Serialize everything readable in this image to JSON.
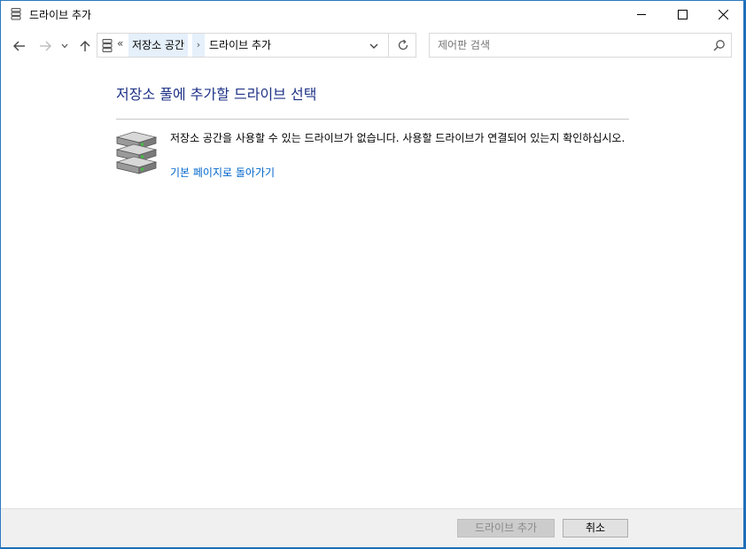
{
  "window": {
    "title": "드라이브 추가",
    "icon": "storage-spaces-icon",
    "controls": [
      "minimize-icon",
      "maximize-icon",
      "close-icon"
    ]
  },
  "nav": {
    "overflow": "«",
    "breadcrumb": [
      "저장소 공간",
      "드라이브 추가"
    ],
    "separator": "›",
    "search_placeholder": "제어판 검색"
  },
  "content": {
    "title": "저장소 풀에 추가할 드라이브 선택",
    "message": "저장소 공간을 사용할 수 있는 드라이브가 없습니다. 사용할 드라이브가 연결되어 있는지 확인하십시오.",
    "link": "기본 페이지로 돌아가기"
  },
  "footer": {
    "add_button": "드라이브 추가",
    "cancel_button": "취소"
  },
  "colors": {
    "title_blue": "#1e3287",
    "link_blue": "#0066cc",
    "window_border": "#2b79c2"
  }
}
